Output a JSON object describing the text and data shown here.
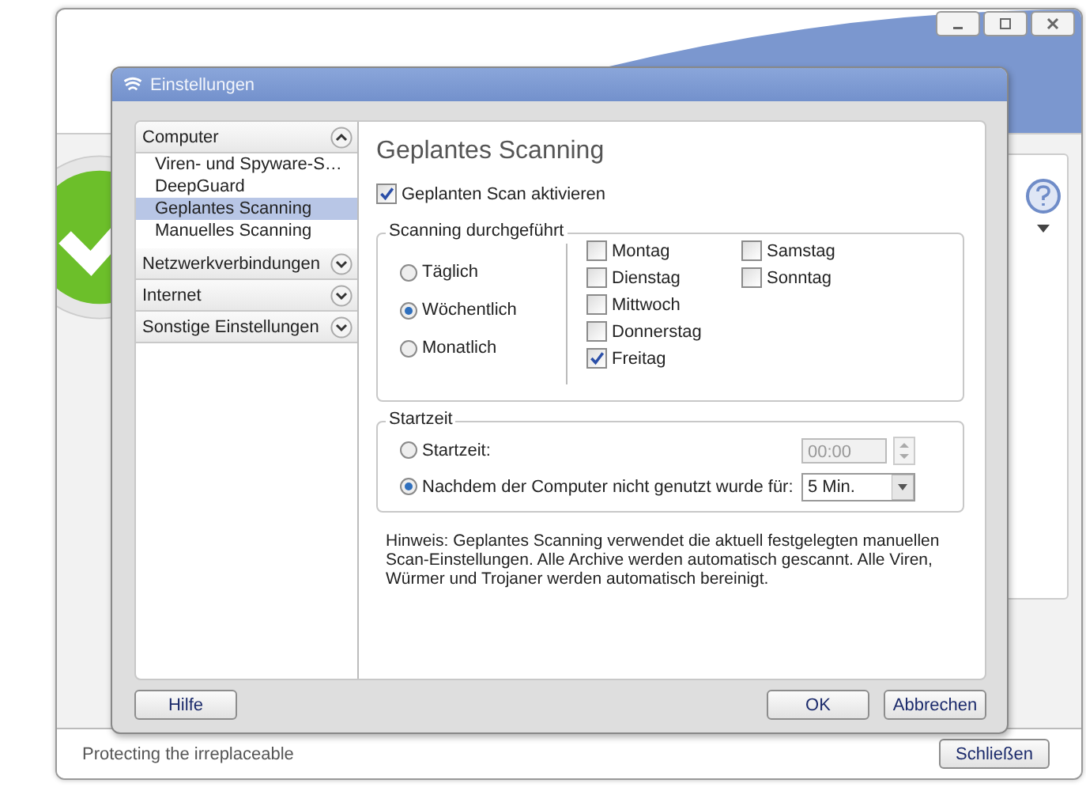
{
  "app_window": {
    "status_text": "Protecting the irreplaceable",
    "close_button": "Schließen"
  },
  "dialog": {
    "title": "Einstellungen"
  },
  "sidebar": [
    {
      "label": "Computer",
      "expanded": true,
      "children": [
        {
          "label": "Viren- und Spyware-S…",
          "selected": false
        },
        {
          "label": "DeepGuard",
          "selected": false
        },
        {
          "label": "Geplantes Scanning",
          "selected": true
        },
        {
          "label": "Manuelles Scanning",
          "selected": false
        }
      ]
    },
    {
      "label": "Netzwerkverbindungen",
      "expanded": false
    },
    {
      "label": "Internet",
      "expanded": false
    },
    {
      "label": "Sonstige Einstellungen",
      "expanded": false
    }
  ],
  "page": {
    "heading": "Geplantes Scanning",
    "enable": {
      "label": "Geplanten Scan aktivieren",
      "checked": true
    },
    "frequency": {
      "title": "Scanning durchgeführt",
      "options": [
        {
          "label": "Täglich",
          "selected": false
        },
        {
          "label": "Wöchentlich",
          "selected": true
        },
        {
          "label": "Monatlich",
          "selected": false
        }
      ],
      "days": [
        {
          "label": "Montag",
          "checked": false
        },
        {
          "label": "Dienstag",
          "checked": false
        },
        {
          "label": "Mittwoch",
          "checked": false
        },
        {
          "label": "Donnerstag",
          "checked": false
        },
        {
          "label": "Freitag",
          "checked": true
        },
        {
          "label": "Samstag",
          "checked": false
        },
        {
          "label": "Sonntag",
          "checked": false
        }
      ]
    },
    "start": {
      "title": "Startzeit",
      "options": [
        {
          "label": "Startzeit:",
          "selected": false,
          "kind": "time",
          "value": "00:00",
          "disabled": true
        },
        {
          "label": "Nachdem der Computer nicht genutzt wurde für:",
          "selected": true,
          "kind": "dropdown",
          "value": "5 Min.",
          "disabled": false
        }
      ]
    },
    "note": "Hinweis: Geplantes Scanning verwendet die aktuell festgelegten manuellen Scan-Einstellungen. Alle Archive werden automatisch gescannt. Alle Viren, Würmer und Trojaner werden automatisch bereinigt."
  },
  "buttons": {
    "help": "Hilfe",
    "ok": "OK",
    "cancel": "Abbrechen"
  }
}
